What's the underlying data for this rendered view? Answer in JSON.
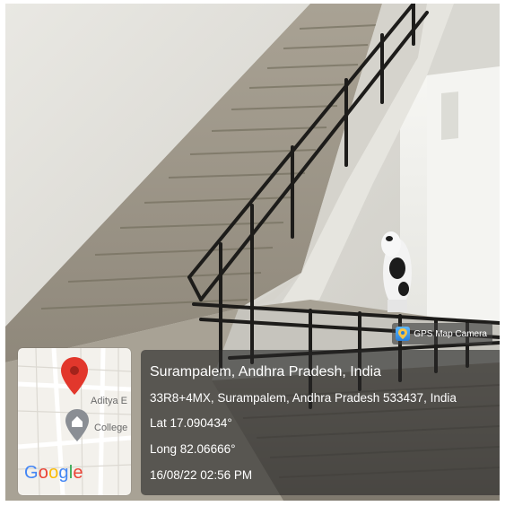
{
  "overlay": {
    "app_badge_label": "GPS Map Camera",
    "app_icon": "map-pin-camera-icon",
    "map": {
      "labels": [
        "Aditya E",
        "College"
      ],
      "logo_letters": [
        {
          "ch": "G",
          "color": "#4285F4"
        },
        {
          "ch": "o",
          "color": "#EA4335"
        },
        {
          "ch": "o",
          "color": "#FBBC05"
        },
        {
          "ch": "g",
          "color": "#4285F4"
        },
        {
          "ch": "l",
          "color": "#34A853"
        },
        {
          "ch": "e",
          "color": "#EA4335"
        }
      ],
      "pin_color": "#e2372c",
      "marker_icon": "location-marker-icon"
    },
    "place_title": "Surampalem, Andhra Pradesh, India",
    "address": "33R8+4MX, Surampalem, Andhra Pradesh 533437, India",
    "latitude": "Lat 17.090434°",
    "longitude": "Long 82.06666°",
    "datetime": "16/08/22 02:56 PM"
  }
}
